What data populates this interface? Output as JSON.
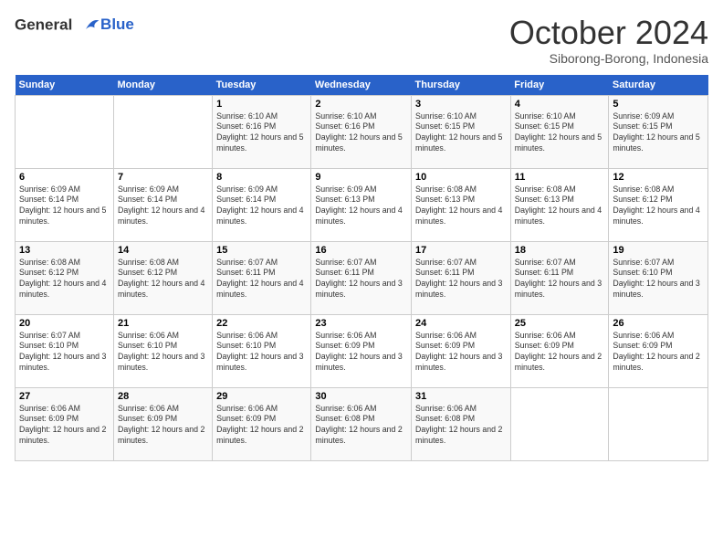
{
  "logo": {
    "line1": "General",
    "line2": "Blue"
  },
  "title": "October 2024",
  "location": "Siborong-Borong, Indonesia",
  "days_header": [
    "Sunday",
    "Monday",
    "Tuesday",
    "Wednesday",
    "Thursday",
    "Friday",
    "Saturday"
  ],
  "weeks": [
    [
      {
        "day": "",
        "info": ""
      },
      {
        "day": "",
        "info": ""
      },
      {
        "day": "1",
        "info": "Sunrise: 6:10 AM\nSunset: 6:16 PM\nDaylight: 12 hours and 5 minutes."
      },
      {
        "day": "2",
        "info": "Sunrise: 6:10 AM\nSunset: 6:16 PM\nDaylight: 12 hours and 5 minutes."
      },
      {
        "day": "3",
        "info": "Sunrise: 6:10 AM\nSunset: 6:15 PM\nDaylight: 12 hours and 5 minutes."
      },
      {
        "day": "4",
        "info": "Sunrise: 6:10 AM\nSunset: 6:15 PM\nDaylight: 12 hours and 5 minutes."
      },
      {
        "day": "5",
        "info": "Sunrise: 6:09 AM\nSunset: 6:15 PM\nDaylight: 12 hours and 5 minutes."
      }
    ],
    [
      {
        "day": "6",
        "info": "Sunrise: 6:09 AM\nSunset: 6:14 PM\nDaylight: 12 hours and 5 minutes."
      },
      {
        "day": "7",
        "info": "Sunrise: 6:09 AM\nSunset: 6:14 PM\nDaylight: 12 hours and 4 minutes."
      },
      {
        "day": "8",
        "info": "Sunrise: 6:09 AM\nSunset: 6:14 PM\nDaylight: 12 hours and 4 minutes."
      },
      {
        "day": "9",
        "info": "Sunrise: 6:09 AM\nSunset: 6:13 PM\nDaylight: 12 hours and 4 minutes."
      },
      {
        "day": "10",
        "info": "Sunrise: 6:08 AM\nSunset: 6:13 PM\nDaylight: 12 hours and 4 minutes."
      },
      {
        "day": "11",
        "info": "Sunrise: 6:08 AM\nSunset: 6:13 PM\nDaylight: 12 hours and 4 minutes."
      },
      {
        "day": "12",
        "info": "Sunrise: 6:08 AM\nSunset: 6:12 PM\nDaylight: 12 hours and 4 minutes."
      }
    ],
    [
      {
        "day": "13",
        "info": "Sunrise: 6:08 AM\nSunset: 6:12 PM\nDaylight: 12 hours and 4 minutes."
      },
      {
        "day": "14",
        "info": "Sunrise: 6:08 AM\nSunset: 6:12 PM\nDaylight: 12 hours and 4 minutes."
      },
      {
        "day": "15",
        "info": "Sunrise: 6:07 AM\nSunset: 6:11 PM\nDaylight: 12 hours and 4 minutes."
      },
      {
        "day": "16",
        "info": "Sunrise: 6:07 AM\nSunset: 6:11 PM\nDaylight: 12 hours and 3 minutes."
      },
      {
        "day": "17",
        "info": "Sunrise: 6:07 AM\nSunset: 6:11 PM\nDaylight: 12 hours and 3 minutes."
      },
      {
        "day": "18",
        "info": "Sunrise: 6:07 AM\nSunset: 6:11 PM\nDaylight: 12 hours and 3 minutes."
      },
      {
        "day": "19",
        "info": "Sunrise: 6:07 AM\nSunset: 6:10 PM\nDaylight: 12 hours and 3 minutes."
      }
    ],
    [
      {
        "day": "20",
        "info": "Sunrise: 6:07 AM\nSunset: 6:10 PM\nDaylight: 12 hours and 3 minutes."
      },
      {
        "day": "21",
        "info": "Sunrise: 6:06 AM\nSunset: 6:10 PM\nDaylight: 12 hours and 3 minutes."
      },
      {
        "day": "22",
        "info": "Sunrise: 6:06 AM\nSunset: 6:10 PM\nDaylight: 12 hours and 3 minutes."
      },
      {
        "day": "23",
        "info": "Sunrise: 6:06 AM\nSunset: 6:09 PM\nDaylight: 12 hours and 3 minutes."
      },
      {
        "day": "24",
        "info": "Sunrise: 6:06 AM\nSunset: 6:09 PM\nDaylight: 12 hours and 3 minutes."
      },
      {
        "day": "25",
        "info": "Sunrise: 6:06 AM\nSunset: 6:09 PM\nDaylight: 12 hours and 2 minutes."
      },
      {
        "day": "26",
        "info": "Sunrise: 6:06 AM\nSunset: 6:09 PM\nDaylight: 12 hours and 2 minutes."
      }
    ],
    [
      {
        "day": "27",
        "info": "Sunrise: 6:06 AM\nSunset: 6:09 PM\nDaylight: 12 hours and 2 minutes."
      },
      {
        "day": "28",
        "info": "Sunrise: 6:06 AM\nSunset: 6:09 PM\nDaylight: 12 hours and 2 minutes."
      },
      {
        "day": "29",
        "info": "Sunrise: 6:06 AM\nSunset: 6:09 PM\nDaylight: 12 hours and 2 minutes."
      },
      {
        "day": "30",
        "info": "Sunrise: 6:06 AM\nSunset: 6:08 PM\nDaylight: 12 hours and 2 minutes."
      },
      {
        "day": "31",
        "info": "Sunrise: 6:06 AM\nSunset: 6:08 PM\nDaylight: 12 hours and 2 minutes."
      },
      {
        "day": "",
        "info": ""
      },
      {
        "day": "",
        "info": ""
      }
    ]
  ]
}
